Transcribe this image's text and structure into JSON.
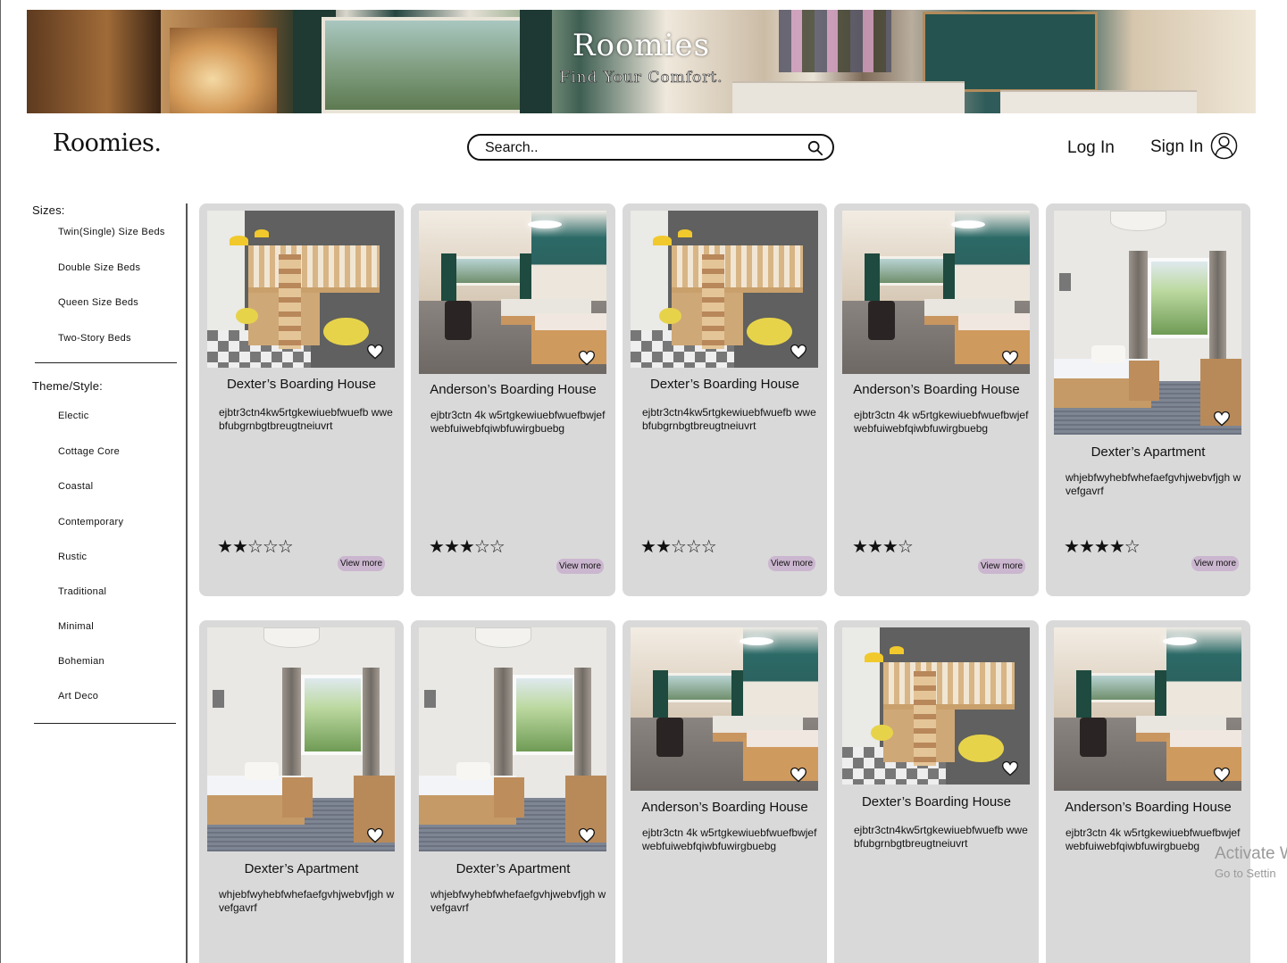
{
  "banner": {
    "title": "Roomies",
    "tagline": "Find Your Comfort."
  },
  "header": {
    "logo": "Roomies.",
    "search_placeholder": "Search..",
    "login": "Log In",
    "signin": "Sign In"
  },
  "sidebar": {
    "sizes_heading": "Sizes:",
    "sizes": [
      "Twin(Single) Size Beds",
      "Double Size Beds",
      "Queen Size Beds",
      "Two-Story Beds"
    ],
    "theme_heading": "Theme/Style:",
    "themes": [
      "Electic",
      "Cottage Core",
      "Coastal",
      "Contemporary",
      "Rustic",
      "Traditional",
      "Minimal",
      "Bohemian",
      "Art Deco"
    ]
  },
  "cards": [
    {
      "title": "Dexter’s Boarding House",
      "desc": "ejbtr3ctn4kw5rtgkewiuebfwuefb wwebfubgrnbgtbreugtneiuvrt",
      "rating": 2,
      "max": 5,
      "more": "View more",
      "image": "loft-bed-photo"
    },
    {
      "title": "Anderson’s Boarding House",
      "desc": "ejbtr3ctn 4k w5rtgkewiuebfwuefbwjef webfuiwebfqiwbfuwirgbuebg",
      "rating": 3,
      "max": 5,
      "more": "View more",
      "image": "twin-room-photo"
    },
    {
      "title": "Dexter’s Boarding House",
      "desc": "ejbtr3ctn4kw5rtgkewiuebfwuefb wwebfubgrnbgtbreugtneiuvrt",
      "rating": 2,
      "max": 5,
      "more": "View more",
      "image": "loft-bed-photo"
    },
    {
      "title": "Anderson’s Boarding House",
      "desc": "ejbtr3ctn 4k w5rtgkewiuebfwuefbwjef webfuiwebfqiwbfuwirgbuebg",
      "rating": 3,
      "max": 4,
      "more": "View more",
      "image": "twin-room-photo"
    },
    {
      "title": "Dexter’s Apartment",
      "desc": "whjebfwyhebfwhefaefgvhjwebvfjgh wvefgavrf",
      "rating": 4,
      "max": 5,
      "more": "View more",
      "image": "single-room-photo"
    },
    {
      "title": "Dexter’s Apartment",
      "desc": "whjebfwyhebfwhefaefgvhjwebvfjgh wvefgavrf",
      "image": "single-room-photo"
    },
    {
      "title": "Dexter’s Apartment",
      "desc": "whjebfwyhebfwhefaefgvhjwebvfjgh wvefgavrf",
      "image": "single-room-photo"
    },
    {
      "title": "Anderson’s Boarding House",
      "desc": "ejbtr3ctn 4k w5rtgkewiuebfwuefbwjef webfuiwebfqiwbfuwirgbuebg",
      "image": "twin-room-photo"
    },
    {
      "title": "Dexter’s Boarding House",
      "desc": "ejbtr3ctn4kw5rtgkewiuebfwuefb wwebfubgrnbgtbreugtneiuvrt",
      "image": "loft-bed-photo"
    },
    {
      "title": "Anderson’s Boarding House",
      "desc": "ejbtr3ctn 4k w5rtgkewiuebfwuefbwjef webfuiwebfqiwbfuwirgbuebg",
      "image": "twin-room-photo"
    }
  ],
  "watermark": {
    "line1": "Activate W",
    "line2": "Go to Settin"
  }
}
